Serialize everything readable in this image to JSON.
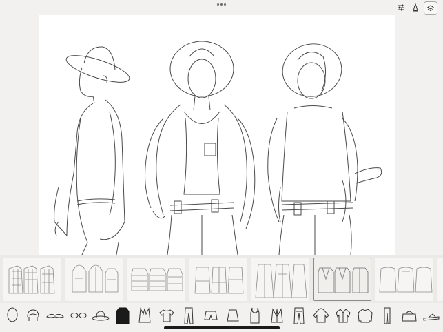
{
  "app": {
    "toolbar": {
      "menu_icon": "ellipsis-icon",
      "buttons": [
        {
          "name": "adjust-sliders-icon"
        },
        {
          "name": "ink-bottle-icon"
        },
        {
          "name": "layers-icon"
        }
      ]
    },
    "canvas": {
      "figures": [
        "side-view-figure",
        "front-view-figure",
        "back-view-figure"
      ]
    },
    "template_strip": {
      "items": [
        {
          "name": "template-plaid-shirts",
          "selected": false
        },
        {
          "name": "template-hoodies",
          "selected": false
        },
        {
          "name": "template-puffer-jackets",
          "selected": false
        },
        {
          "name": "template-belted-jackets",
          "selected": false
        },
        {
          "name": "template-long-coats",
          "selected": false
        },
        {
          "name": "template-blazers",
          "selected": true
        },
        {
          "name": "template-sweaters",
          "selected": false
        }
      ]
    },
    "category_bar": {
      "items": [
        {
          "name": "head-icon"
        },
        {
          "name": "hair-icon"
        },
        {
          "name": "mustache-icon"
        },
        {
          "name": "glasses-icon"
        },
        {
          "name": "hat-icon"
        },
        {
          "name": "coat-icon",
          "selected": true
        },
        {
          "name": "vest-icon"
        },
        {
          "name": "tshirt-icon"
        },
        {
          "name": "trousers-icon"
        },
        {
          "name": "shorts-icon"
        },
        {
          "name": "skirt-icon"
        },
        {
          "name": "tank-top-icon"
        },
        {
          "name": "waistcoat-icon"
        },
        {
          "name": "jeans-icon"
        },
        {
          "name": "hoodie-icon"
        },
        {
          "name": "shirt-icon"
        },
        {
          "name": "sweater-icon"
        },
        {
          "name": "leggings-icon"
        },
        {
          "name": "bag-icon"
        },
        {
          "name": "sandals-icon"
        }
      ]
    }
  }
}
